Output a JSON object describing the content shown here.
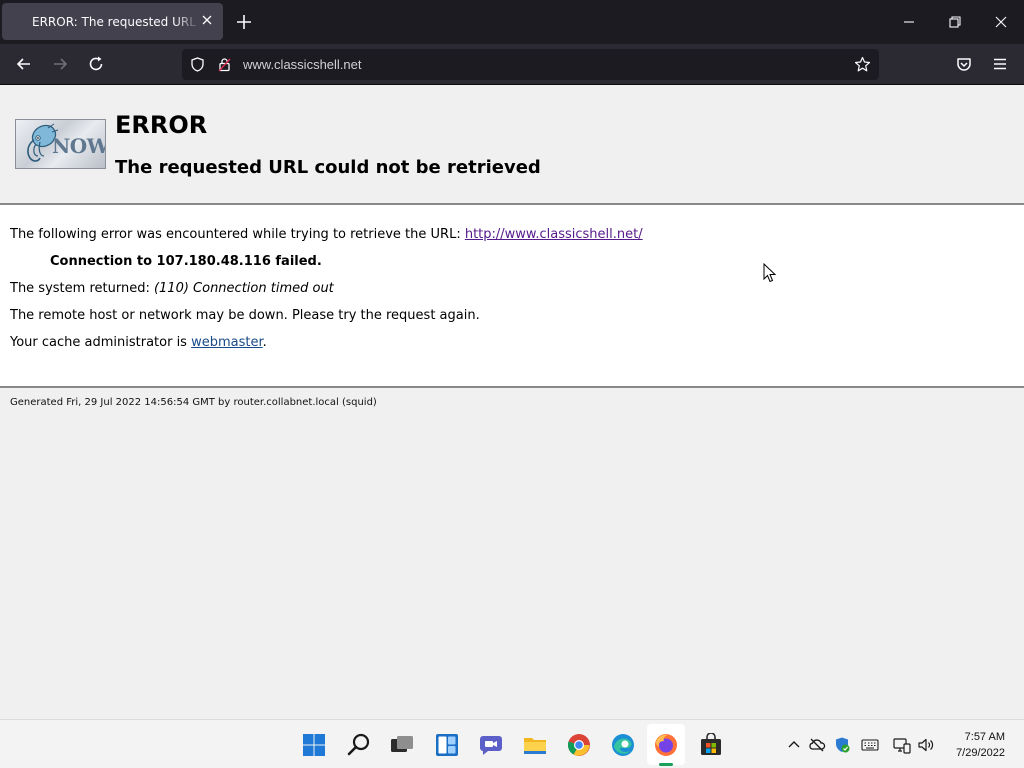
{
  "browser": {
    "tab_title": "ERROR: The requested URL could not be retrieved",
    "url_display": "www.classicshell.net"
  },
  "page": {
    "logo_text": "NOW",
    "title": "ERROR",
    "subtitle": "The requested URL could not be retrieved",
    "line1_prefix": "The following error was encountered while trying to retrieve the URL: ",
    "line1_link": "http://www.classicshell.net/",
    "line2": "Connection to 107.180.48.116 failed.",
    "line3_prefix": "The system returned: ",
    "line3_detail": "(110) Connection timed out",
    "line4": "The remote host or network may be down. Please try the request again.",
    "line5_prefix": "Your cache administrator is ",
    "line5_link": "webmaster",
    "line5_suffix": ".",
    "footer": "Generated Fri, 29 Jul 2022 14:56:54 GMT by router.collabnet.local (squid)"
  },
  "taskbar": {
    "time": "7:57 AM",
    "date": "7/29/2022"
  },
  "colors": {
    "tab_bar": "#1c1b22",
    "nav_bar": "#2b2a33",
    "link": "#1a4a8a",
    "visited_link": "#551a8b",
    "firefox_indicator": "#1aa05a"
  }
}
